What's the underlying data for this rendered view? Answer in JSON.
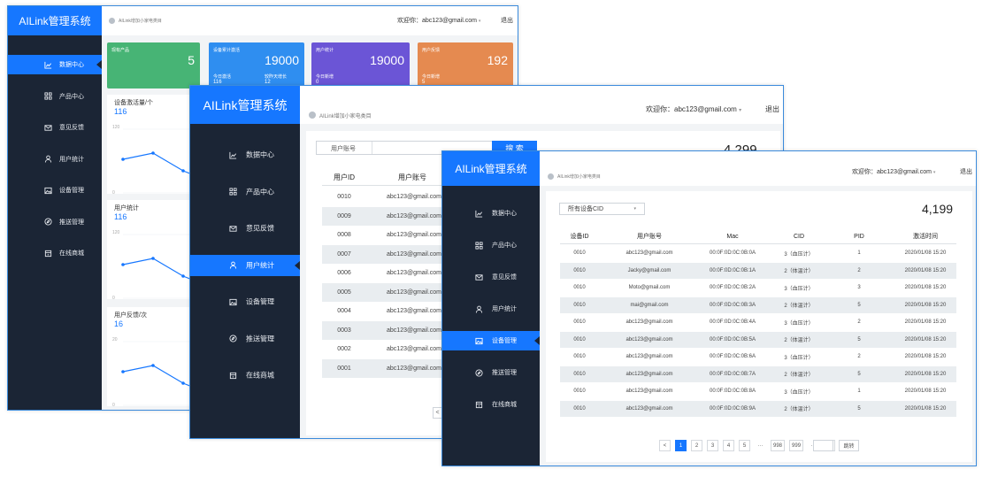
{
  "app": {
    "brand": "AILink管理系统"
  },
  "topbar": {
    "breadcrumb": "AILink增加小家电类目",
    "welcome": "欢迎你：abc123@gmail.com",
    "logout": "退出"
  },
  "sidebar": {
    "items": [
      {
        "label": "数据中心",
        "icon": "chart-icon"
      },
      {
        "label": "产品中心",
        "icon": "grid-icon"
      },
      {
        "label": "意见反馈",
        "icon": "mail-icon"
      },
      {
        "label": "用户统计",
        "icon": "user-icon"
      },
      {
        "label": "设备管理",
        "icon": "image-icon"
      },
      {
        "label": "推送管理",
        "icon": "compass-icon"
      },
      {
        "label": "在线商城",
        "icon": "store-icon"
      }
    ]
  },
  "window1": {
    "cards": [
      {
        "title": "现有产品",
        "value": "5",
        "color": "#47b475",
        "sub": []
      },
      {
        "title": "设备累计激活",
        "value": "19000",
        "color": "#2f8ef0",
        "sub": [
          {
            "label": "今日激活",
            "value": "116"
          },
          {
            "label": "较昨天增长",
            "value": "12"
          }
        ]
      },
      {
        "title": "用户统计",
        "value": "19000",
        "color": "#6b55d6",
        "sub": [
          {
            "label": "今日新增",
            "value": "0"
          }
        ]
      },
      {
        "title": "用户反馈",
        "value": "192",
        "color": "#e58a50",
        "sub": [
          {
            "label": "今日新增",
            "value": "5"
          }
        ]
      }
    ],
    "panels": [
      {
        "title": "设备激活量/个",
        "value": "116",
        "axis_top": "120",
        "axis_bottom": "0"
      },
      {
        "title": "用户统计",
        "value": "116",
        "axis_top": "120",
        "axis_bottom": "0"
      },
      {
        "title": "用户反馈/次",
        "value": "16",
        "axis_top": "20",
        "axis_bottom": "0"
      }
    ]
  },
  "window2": {
    "search": {
      "label": "用户账号",
      "button": "搜 索"
    },
    "total": "4,299",
    "headers": {
      "id": "用户ID",
      "account": "用户账号"
    },
    "rows": [
      {
        "id": "0010",
        "account": "abc123@gmail.com"
      },
      {
        "id": "0009",
        "account": "abc123@gmail.com"
      },
      {
        "id": "0008",
        "account": "abc123@gmail.com"
      },
      {
        "id": "0007",
        "account": "abc123@gmail.com"
      },
      {
        "id": "0006",
        "account": "abc123@gmail.com"
      },
      {
        "id": "0005",
        "account": "abc123@gmail.com"
      },
      {
        "id": "0004",
        "account": "abc123@gmail.com"
      },
      {
        "id": "0003",
        "account": "abc123@gmail.com"
      },
      {
        "id": "0002",
        "account": "abc123@gmail.com"
      },
      {
        "id": "0001",
        "account": "abc123@gmail.com"
      }
    ],
    "pager_prev": "<"
  },
  "window3": {
    "filter": "所有设备CID",
    "total": "4,199",
    "headers": {
      "device_id": "设备ID",
      "account": "用户账号",
      "mac": "Mac",
      "cid": "CID",
      "pid": "PID",
      "time": "激活时间"
    },
    "rows": [
      {
        "device_id": "0010",
        "account": "abc123@gmail.com",
        "mac": "00:0F:0D:0C:0B:0A",
        "cid": "3（血压计）",
        "pid": "1",
        "time": "2020/01/08  15:20"
      },
      {
        "device_id": "0010",
        "account": "Jacky@gmail.com",
        "mac": "00:0F:0D:0C:0B:1A",
        "cid": "2（体温计）",
        "pid": "2",
        "time": "2020/01/08  15:20"
      },
      {
        "device_id": "0010",
        "account": "Moto@gmail.com",
        "mac": "00:0F:0D:0C:0B:2A",
        "cid": "3（血压计）",
        "pid": "3",
        "time": "2020/01/08  15:20"
      },
      {
        "device_id": "0010",
        "account": "mai@gmail.com",
        "mac": "00:0F:0D:0C:0B:3A",
        "cid": "2（体温计）",
        "pid": "5",
        "time": "2020/01/08  15:20"
      },
      {
        "device_id": "0010",
        "account": "abc123@gmail.com",
        "mac": "00:0F:0D:0C:0B:4A",
        "cid": "3（血压计）",
        "pid": "2",
        "time": "2020/01/08  15:20"
      },
      {
        "device_id": "0010",
        "account": "abc123@gmail.com",
        "mac": "00:0F:0D:0C:0B:5A",
        "cid": "2（体温计）",
        "pid": "5",
        "time": "2020/01/08  15:20"
      },
      {
        "device_id": "0010",
        "account": "abc123@gmail.com",
        "mac": "00:0F:0D:0C:0B:6A",
        "cid": "3（血压计）",
        "pid": "2",
        "time": "2020/01/08  15:20"
      },
      {
        "device_id": "0010",
        "account": "abc123@gmail.com",
        "mac": "00:0F:0D:0C:0B:7A",
        "cid": "2（体温计）",
        "pid": "5",
        "time": "2020/01/08  15:20"
      },
      {
        "device_id": "0010",
        "account": "abc123@gmail.com",
        "mac": "00:0F:0D:0C:0B:8A",
        "cid": "3（血压计）",
        "pid": "1",
        "time": "2020/01/08  15:20"
      },
      {
        "device_id": "0010",
        "account": "abc123@gmail.com",
        "mac": "00:0F:0D:0C:0B:9A",
        "cid": "2（体温计）",
        "pid": "5",
        "time": "2020/01/08  15:20"
      }
    ],
    "pagination": [
      "<",
      "1",
      "2",
      "3",
      "4",
      "5",
      "···",
      "998",
      "999",
      "···",
      ">"
    ],
    "current_page": "1",
    "jump": "跳转"
  },
  "colors": {
    "accent": "#1677ff",
    "sidebar": "#1b2535",
    "alt_row": "#e9edf0"
  }
}
